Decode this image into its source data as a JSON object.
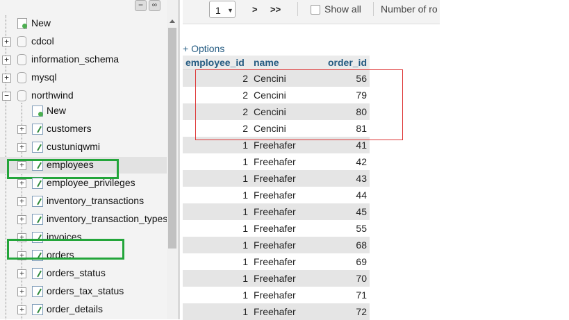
{
  "nav": {
    "tree": [
      {
        "kind": "new",
        "label": "New",
        "level": 0
      },
      {
        "kind": "db",
        "label": "cdcol",
        "expanded": false
      },
      {
        "kind": "db",
        "label": "information_schema",
        "expanded": false
      },
      {
        "kind": "db",
        "label": "mysql",
        "expanded": false
      },
      {
        "kind": "db",
        "label": "northwind",
        "expanded": true
      },
      {
        "kind": "new",
        "label": "New",
        "level": 1
      },
      {
        "kind": "table",
        "label": "customers"
      },
      {
        "kind": "table",
        "label": "custuniqwmi"
      },
      {
        "kind": "table",
        "label": "employees",
        "highlighted": true
      },
      {
        "kind": "table",
        "label": "employee_privileges"
      },
      {
        "kind": "table",
        "label": "inventory_transactions"
      },
      {
        "kind": "table",
        "label": "inventory_transaction_types"
      },
      {
        "kind": "table",
        "label": "invoices"
      },
      {
        "kind": "table",
        "label": "orders",
        "highlighted": true
      },
      {
        "kind": "table",
        "label": "orders_status"
      },
      {
        "kind": "table",
        "label": "orders_tax_status"
      },
      {
        "kind": "table",
        "label": "order_details"
      }
    ],
    "controls": {
      "collapse_icon": "minus-icon",
      "link_icon": "link-icon"
    }
  },
  "toolbar": {
    "page_value": "1",
    "next_label": ">",
    "last_label": ">>",
    "show_all_label": "Show all",
    "show_all_checked": false,
    "rows_label": "Number of ro"
  },
  "options_label": "+ Options",
  "results": {
    "columns": [
      "employee_id",
      "name",
      "order_id"
    ],
    "rows": [
      [
        "2",
        "Cencini",
        "56"
      ],
      [
        "2",
        "Cencini",
        "79"
      ],
      [
        "2",
        "Cencini",
        "80"
      ],
      [
        "2",
        "Cencini",
        "81"
      ],
      [
        "1",
        "Freehafer",
        "41"
      ],
      [
        "1",
        "Freehafer",
        "42"
      ],
      [
        "1",
        "Freehafer",
        "43"
      ],
      [
        "1",
        "Freehafer",
        "44"
      ],
      [
        "1",
        "Freehafer",
        "45"
      ],
      [
        "1",
        "Freehafer",
        "55"
      ],
      [
        "1",
        "Freehafer",
        "68"
      ],
      [
        "1",
        "Freehafer",
        "69"
      ],
      [
        "1",
        "Freehafer",
        "70"
      ],
      [
        "1",
        "Freehafer",
        "71"
      ],
      [
        "1",
        "Freehafer",
        "72"
      ]
    ]
  },
  "colors": {
    "highlight_green": "#23a53a",
    "highlight_red": "#dd3333",
    "header_text": "#235a81"
  }
}
